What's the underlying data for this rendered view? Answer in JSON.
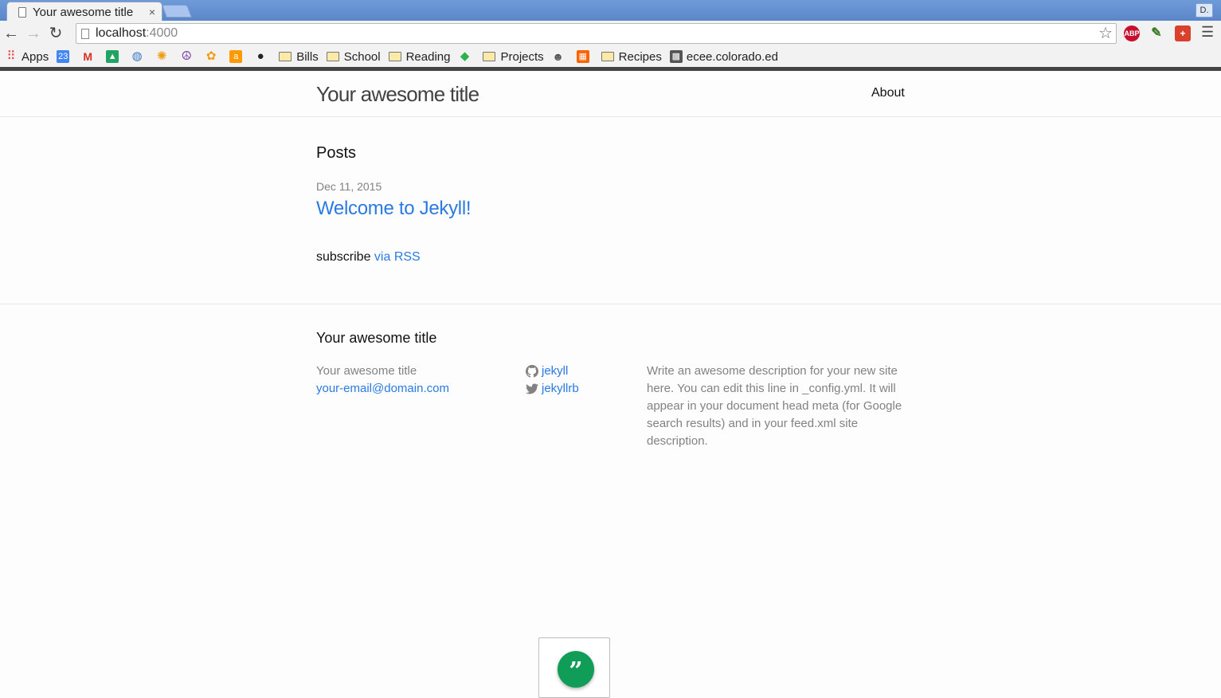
{
  "browser": {
    "tab_title": "Your awesome title",
    "tab_close": "×",
    "user_badge": "D.",
    "url_host": "localhost",
    "url_port": ":4000",
    "ext_abp": "ABP",
    "bookmarks": [
      {
        "label": "Apps",
        "icon": "apps-grid-icon"
      },
      {
        "label": "",
        "icon": "calendar-icon"
      },
      {
        "label": "",
        "icon": "gmail-icon"
      },
      {
        "label": "",
        "icon": "drive-icon"
      },
      {
        "label": "",
        "icon": "globe-icon"
      },
      {
        "label": "",
        "icon": "sun-icon"
      },
      {
        "label": "",
        "icon": "peace-icon"
      },
      {
        "label": "",
        "icon": "flower-icon"
      },
      {
        "label": "",
        "icon": "amazon-icon"
      },
      {
        "label": "",
        "icon": "github-icon"
      },
      {
        "label": "Bills",
        "icon": "folder-icon"
      },
      {
        "label": "School",
        "icon": "folder-icon"
      },
      {
        "label": "Reading",
        "icon": "folder-icon"
      },
      {
        "label": "",
        "icon": "leaf-icon"
      },
      {
        "label": "Projects",
        "icon": "folder-icon"
      },
      {
        "label": "",
        "icon": "reddit-icon"
      },
      {
        "label": "",
        "icon": "homedepot-icon"
      },
      {
        "label": "Recipes",
        "icon": "folder-icon"
      },
      {
        "label": "ecee.colorado.ed",
        "icon": "site-icon"
      }
    ]
  },
  "site": {
    "title": "Your awesome title",
    "nav_about": "About",
    "posts_heading": "Posts",
    "post": {
      "date": "Dec 11, 2015",
      "title": "Welcome to Jekyll!"
    },
    "subscribe_text": "subscribe ",
    "subscribe_link": "via RSS"
  },
  "footer": {
    "heading": "Your awesome title",
    "col1_title": "Your awesome title",
    "col1_email": "your-email@domain.com",
    "github_user": "jekyll",
    "twitter_user": "jekyllrb",
    "description": "Write an awesome description for your new site here. You can edit this line in _config.yml. It will appear in your document head meta (for Google search results) and in your feed.xml site description."
  },
  "colors": {
    "link": "#2a7ae2",
    "meta": "#828282",
    "hangouts": "#0f9d58"
  }
}
